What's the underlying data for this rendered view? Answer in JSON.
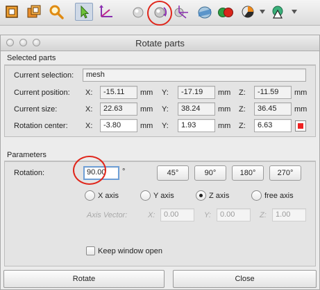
{
  "toolbar": {
    "icons": [
      "frame-icon",
      "copy-frame-icon",
      "zoom-icon",
      "select-arrow-icon",
      "axis-transform-icon",
      "sphere-icon",
      "rotate-part-icon",
      "move-sphere-icon",
      "section-icon",
      "color-spheres-icon",
      "pie-view-icon",
      "render-mode-icon"
    ],
    "colors": {
      "active_bg": "#cfd9e6",
      "highlight": "#e0261b"
    }
  },
  "window": {
    "title": "Rotate parts",
    "selected_parts": {
      "heading": "Selected parts",
      "current_selection_label": "Current selection:",
      "current_selection_value": "mesh",
      "current_position_label": "Current position:",
      "current_size_label": "Current size:",
      "rotation_center_label": "Rotation center:",
      "x_label": "X:",
      "y_label": "Y:",
      "z_label": "Z:",
      "unit": "mm",
      "position": {
        "x": "-15.11",
        "y": "-17.19",
        "z": "-11.59"
      },
      "size": {
        "x": "22.63",
        "y": "38.24",
        "z": "36.45"
      },
      "center": {
        "x": "-3.80",
        "y": "1.93",
        "z": "6.63"
      }
    },
    "parameters": {
      "heading": "Parameters",
      "rotation_label": "Rotation:",
      "rotation_value": "90.00",
      "degree_symbol": "°",
      "preset_buttons": [
        "45°",
        "90°",
        "180°",
        "270°"
      ],
      "axes": [
        {
          "label": "X axis",
          "selected": false
        },
        {
          "label": "Y axis",
          "selected": false
        },
        {
          "label": "Z axis",
          "selected": true
        },
        {
          "label": "free axis",
          "selected": false
        }
      ],
      "axis_vector_label": "Axis Vector:",
      "axis_vector": {
        "x": "0.00",
        "y": "0.00",
        "z": "1.00"
      },
      "axis_x_label": "X:",
      "axis_y_label": "Y:",
      "axis_z_label": "Z:",
      "keep_window_open_label": "Keep window open",
      "keep_window_open_checked": false
    },
    "buttons": {
      "rotate": "Rotate",
      "close": "Close"
    }
  }
}
